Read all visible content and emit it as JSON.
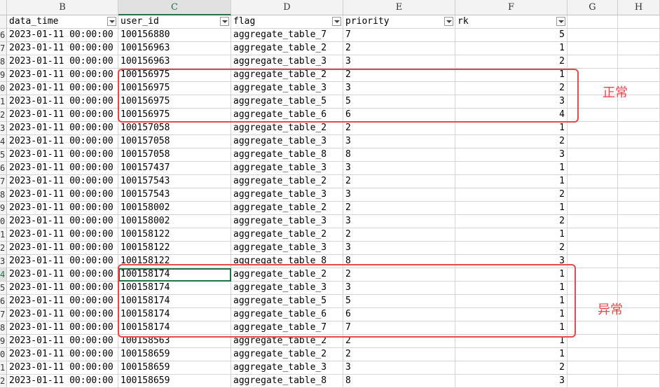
{
  "columns": [
    "B",
    "C",
    "D",
    "E",
    "F",
    "G",
    "H"
  ],
  "headers": {
    "data_time": "data_time",
    "user_id": "user_id",
    "flag": "flag",
    "priority": "priority",
    "rk": "rk"
  },
  "rows": [
    {
      "r": "6",
      "t": "2023-01-11 00:00:00",
      "u": "100156880",
      "f": "aggregate_table_7",
      "p": "7",
      "k": "5"
    },
    {
      "r": "7",
      "t": "2023-01-11 00:00:00",
      "u": "100156963",
      "f": "aggregate_table_2",
      "p": "2",
      "k": "1"
    },
    {
      "r": "8",
      "t": "2023-01-11 00:00:00",
      "u": "100156963",
      "f": "aggregate_table_3",
      "p": "3",
      "k": "2"
    },
    {
      "r": "9",
      "t": "2023-01-11 00:00:00",
      "u": "100156975",
      "f": "aggregate_table_2",
      "p": "2",
      "k": "1"
    },
    {
      "r": "0",
      "t": "2023-01-11 00:00:00",
      "u": "100156975",
      "f": "aggregate_table_3",
      "p": "3",
      "k": "2"
    },
    {
      "r": "1",
      "t": "2023-01-11 00:00:00",
      "u": "100156975",
      "f": "aggregate_table_5",
      "p": "5",
      "k": "3"
    },
    {
      "r": "2",
      "t": "2023-01-11 00:00:00",
      "u": "100156975",
      "f": "aggregate_table_6",
      "p": "6",
      "k": "4"
    },
    {
      "r": "3",
      "t": "2023-01-11 00:00:00",
      "u": "100157058",
      "f": "aggregate_table_2",
      "p": "2",
      "k": "1"
    },
    {
      "r": "4",
      "t": "2023-01-11 00:00:00",
      "u": "100157058",
      "f": "aggregate_table_3",
      "p": "3",
      "k": "2"
    },
    {
      "r": "5",
      "t": "2023-01-11 00:00:00",
      "u": "100157058",
      "f": "aggregate_table_8",
      "p": "8",
      "k": "3"
    },
    {
      "r": "6",
      "t": "2023-01-11 00:00:00",
      "u": "100157437",
      "f": "aggregate_table_3",
      "p": "3",
      "k": "1"
    },
    {
      "r": "7",
      "t": "2023-01-11 00:00:00",
      "u": "100157543",
      "f": "aggregate_table_2",
      "p": "2",
      "k": "1"
    },
    {
      "r": "8",
      "t": "2023-01-11 00:00:00",
      "u": "100157543",
      "f": "aggregate_table_3",
      "p": "3",
      "k": "2"
    },
    {
      "r": "9",
      "t": "2023-01-11 00:00:00",
      "u": "100158002",
      "f": "aggregate_table_2",
      "p": "2",
      "k": "1"
    },
    {
      "r": "0",
      "t": "2023-01-11 00:00:00",
      "u": "100158002",
      "f": "aggregate_table_3",
      "p": "3",
      "k": "2"
    },
    {
      "r": "1",
      "t": "2023-01-11 00:00:00",
      "u": "100158122",
      "f": "aggregate_table_2",
      "p": "2",
      "k": "1"
    },
    {
      "r": "2",
      "t": "2023-01-11 00:00:00",
      "u": "100158122",
      "f": "aggregate_table_3",
      "p": "3",
      "k": "2"
    },
    {
      "r": "3",
      "t": "2023-01-11 00:00:00",
      "u": "100158122",
      "f": "aggregate_table_8",
      "p": "8",
      "k": "3"
    },
    {
      "r": "4",
      "t": "2023-01-11 00:00:00",
      "u": "100158174",
      "f": "aggregate_table_2",
      "p": "2",
      "k": "1"
    },
    {
      "r": "5",
      "t": "2023-01-11 00:00:00",
      "u": "100158174",
      "f": "aggregate_table_3",
      "p": "3",
      "k": "1"
    },
    {
      "r": "6",
      "t": "2023-01-11 00:00:00",
      "u": "100158174",
      "f": "aggregate_table_5",
      "p": "5",
      "k": "1"
    },
    {
      "r": "7",
      "t": "2023-01-11 00:00:00",
      "u": "100158174",
      "f": "aggregate_table_6",
      "p": "6",
      "k": "1"
    },
    {
      "r": "8",
      "t": "2023-01-11 00:00:00",
      "u": "100158174",
      "f": "aggregate_table_7",
      "p": "7",
      "k": "1"
    },
    {
      "r": "9",
      "t": "2023-01-11 00:00:00",
      "u": "100158563",
      "f": "aggregate_table_2",
      "p": "2",
      "k": "1"
    },
    {
      "r": "0",
      "t": "2023-01-11 00:00:00",
      "u": "100158659",
      "f": "aggregate_table_2",
      "p": "2",
      "k": "1"
    },
    {
      "r": "1",
      "t": "2023-01-11 00:00:00",
      "u": "100158659",
      "f": "aggregate_table_3",
      "p": "3",
      "k": "2"
    },
    {
      "r": "2",
      "t": "2023-01-11 00:00:00",
      "u": "100158659",
      "f": "aggregate_table_8",
      "p": "8",
      "k": "3"
    }
  ],
  "annotations": {
    "normal": "正常",
    "abnormal": "异常"
  },
  "colors": {
    "annotation": "#e8474b",
    "selection": "#217346"
  }
}
